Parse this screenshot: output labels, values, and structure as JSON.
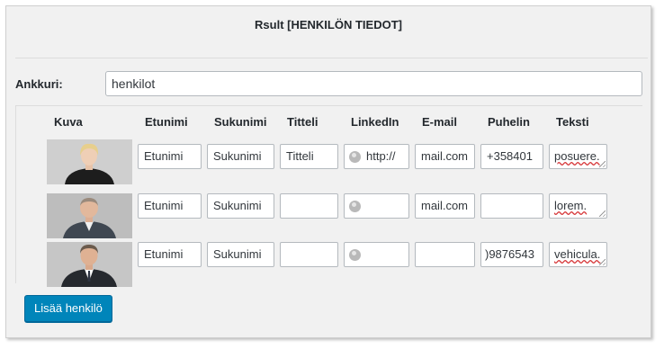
{
  "panel": {
    "title": "Rsult [HENKILÖN TIEDOT]",
    "anchor_label": "Ankkuri:",
    "anchor_value": "henkilot"
  },
  "table": {
    "headers": [
      "Kuva",
      "Etunimi",
      "Sukunimi",
      "Titteli",
      "LinkedIn",
      "E-mail",
      "Puhelin",
      "Teksti"
    ],
    "rows": [
      {
        "photo": "person-woman-blonde",
        "etunimi": "Etunimi",
        "sukunimi": "Sukunimi",
        "titteli": "Titteli",
        "linkedin": "http://",
        "email": "mail.com",
        "puhelin": "+358401",
        "teksti": "posuere."
      },
      {
        "photo": "person-man-bald",
        "etunimi": "Etunimi",
        "sukunimi": "Sukunimi",
        "titteli": "",
        "linkedin": "",
        "email": "mail.com",
        "puhelin": "",
        "teksti": "lorem."
      },
      {
        "photo": "person-man-suit",
        "etunimi": "Etunimi",
        "sukunimi": "Sukunimi",
        "titteli": "",
        "linkedin": "",
        "email": "",
        "puhelin": ")9876543",
        "teksti": "vehicula."
      }
    ]
  },
  "actions": {
    "add_person_label": "Lisää henkilö"
  },
  "colors": {
    "primary_button": "#0085ba",
    "panel_background": "#f1f1f1"
  }
}
